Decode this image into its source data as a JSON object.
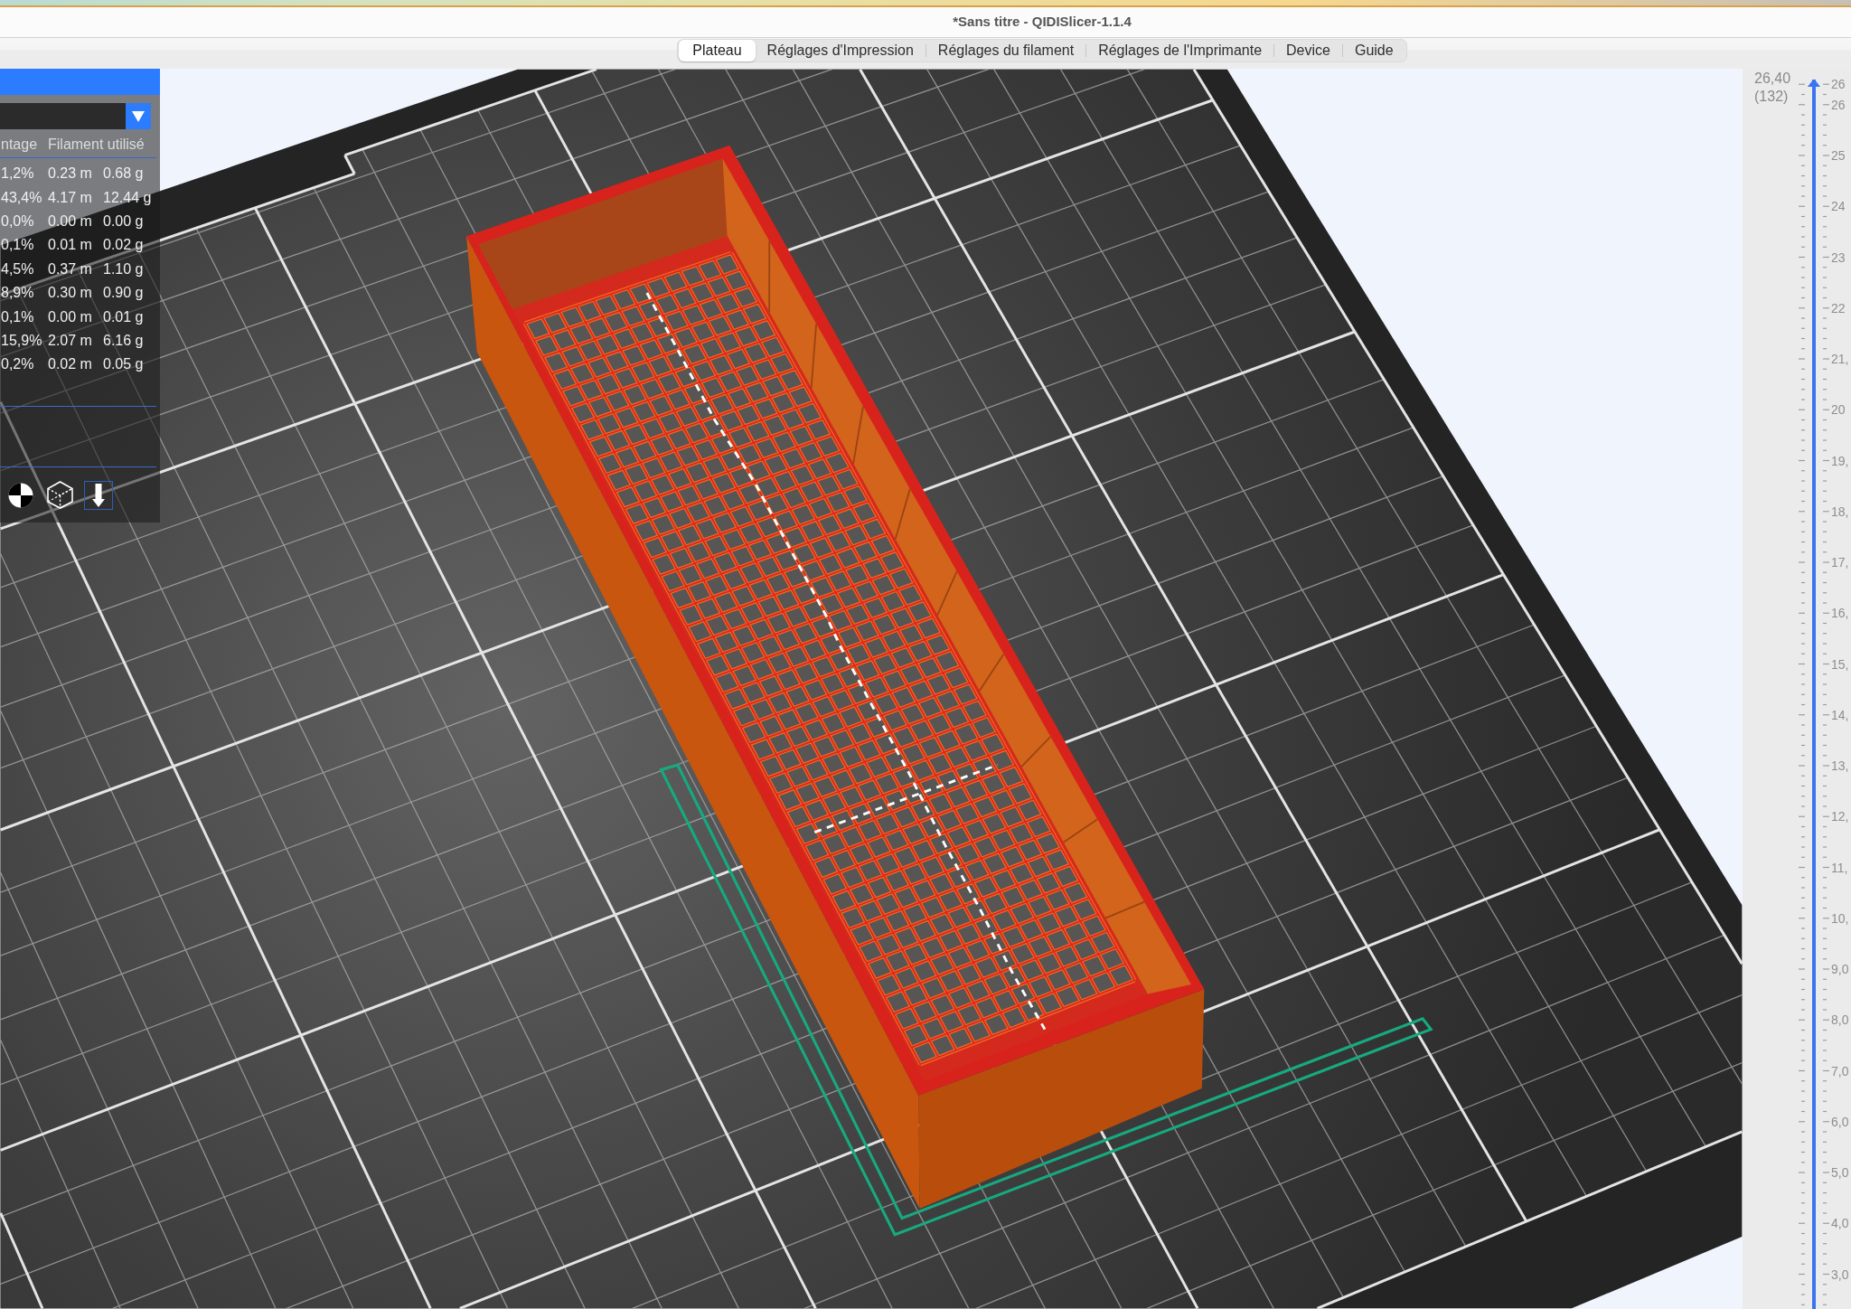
{
  "window": {
    "title": "*Sans titre - QIDISlicer-1.1.4"
  },
  "tabs": [
    {
      "label": "Plateau",
      "selected": true
    },
    {
      "label": "Réglages d'Impression",
      "selected": false
    },
    {
      "label": "Réglages du filament",
      "selected": false
    },
    {
      "label": "Réglages de l'Imprimante",
      "selected": false
    },
    {
      "label": "Device",
      "selected": false
    },
    {
      "label": "Guide",
      "selected": false
    }
  ],
  "legend_panel": {
    "columns": [
      "ntage",
      "Filament utilisé"
    ],
    "rows": [
      {
        "cells": [
          "1,2%",
          "0.23 m",
          "0.68 g"
        ]
      },
      {
        "cells": [
          "43,4%",
          "4.17 m",
          "12.44 g"
        ]
      },
      {
        "cells": [
          "0,0%",
          "0.00 m",
          "0.00 g"
        ]
      },
      {
        "cells": [
          "0,1%",
          "0.01 m",
          "0.02 g"
        ]
      },
      {
        "cells": [
          "4,5%",
          "0.37 m",
          "1.10 g"
        ]
      },
      {
        "cells": [
          "8,9%",
          "0.30 m",
          "0.90 g"
        ]
      },
      {
        "cells": [
          "0,1%",
          "0.00 m",
          "0.01 g"
        ]
      },
      {
        "cells": [
          "15,9%",
          "2.07 m",
          "6.16 g"
        ]
      },
      {
        "cells": [
          "0,2%",
          "0.02 m",
          "0.05 g"
        ]
      }
    ]
  },
  "layer_slider": {
    "value": "26,40",
    "layer": "(132)",
    "level": 1,
    "scale_labels": [
      "26",
      "26",
      "25",
      "24",
      "23",
      "22",
      "21,",
      "20",
      "19,",
      "18,",
      "17,",
      "16,",
      "15,",
      "14,",
      "13,",
      "12,",
      "11,",
      "10,",
      "9,0",
      "8,0",
      "7,0",
      "6,0",
      "5,0",
      "4,0",
      "3,0"
    ]
  }
}
